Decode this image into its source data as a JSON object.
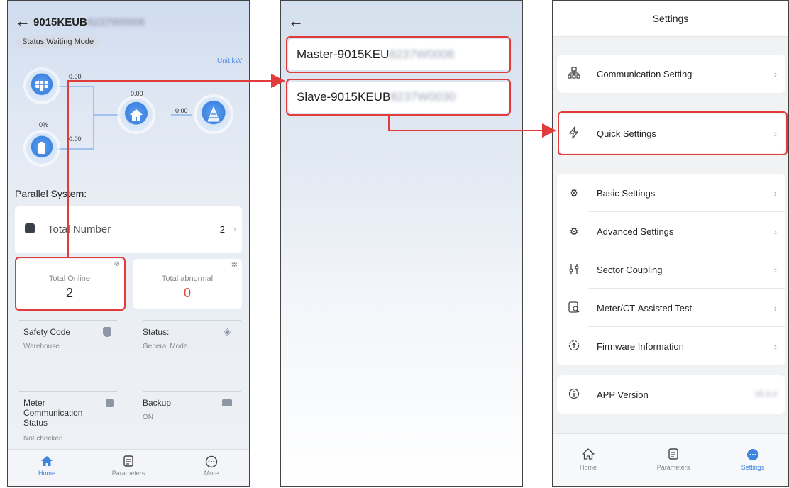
{
  "home_screen": {
    "device_title": "9015KEUB",
    "device_title_hidden": "8237W0008",
    "status": "Status:Waiting Mode",
    "unit": "Unit:kW",
    "flow": {
      "pv": "0.00",
      "load": "0.00",
      "grid": "0.00",
      "battery_soc": "0%",
      "battery": "0.00"
    },
    "parallel_heading": "Parallel System:",
    "total_number_label": "Total Number",
    "total_number_value": "2",
    "total_online_label": "Total Online",
    "total_online_value": "2",
    "total_abnormal_label": "Total abnormal",
    "total_abnormal_value": "0",
    "safety_code_label": "Safety Code",
    "safety_code_value": "Warehouse",
    "status_label": "Status:",
    "status_value": "General Mode",
    "meter_label_1": "Meter",
    "meter_label_2": "Communication",
    "meter_label_3": "Status",
    "meter_value": "Not checked",
    "backup_label": "Backup",
    "backup_value": "ON",
    "tabs": [
      "Home",
      "Parameters",
      "More"
    ]
  },
  "device_list": {
    "items": [
      {
        "label": "Master-9015KEU",
        "hidden": "8237W0008"
      },
      {
        "label": "Slave-9015KEUB",
        "hidden": "8237W0030"
      }
    ]
  },
  "settings": {
    "title": "Settings",
    "items": [
      {
        "label": "Communication Setting",
        "icon": "network-icon"
      },
      {
        "label": "Quick Settings",
        "icon": "lightning-icon"
      },
      {
        "label": "Basic Settings",
        "icon": "gear-icon"
      },
      {
        "label": "Advanced Settings",
        "icon": "advanced-gear-icon"
      },
      {
        "label": "Sector Coupling",
        "icon": "sliders-icon"
      },
      {
        "label": "Meter/CT-Assisted Test",
        "icon": "meter-test-icon"
      },
      {
        "label": "Firmware Information",
        "icon": "firmware-icon"
      }
    ],
    "app_version_label": "APP Version",
    "app_version_value": "V5.6.0",
    "tabs": [
      "Home",
      "Parameters",
      "Settings"
    ]
  },
  "colors": {
    "accent": "#3e83e0",
    "annotation": "#e23b3b",
    "abnormal": "#e5483a"
  }
}
